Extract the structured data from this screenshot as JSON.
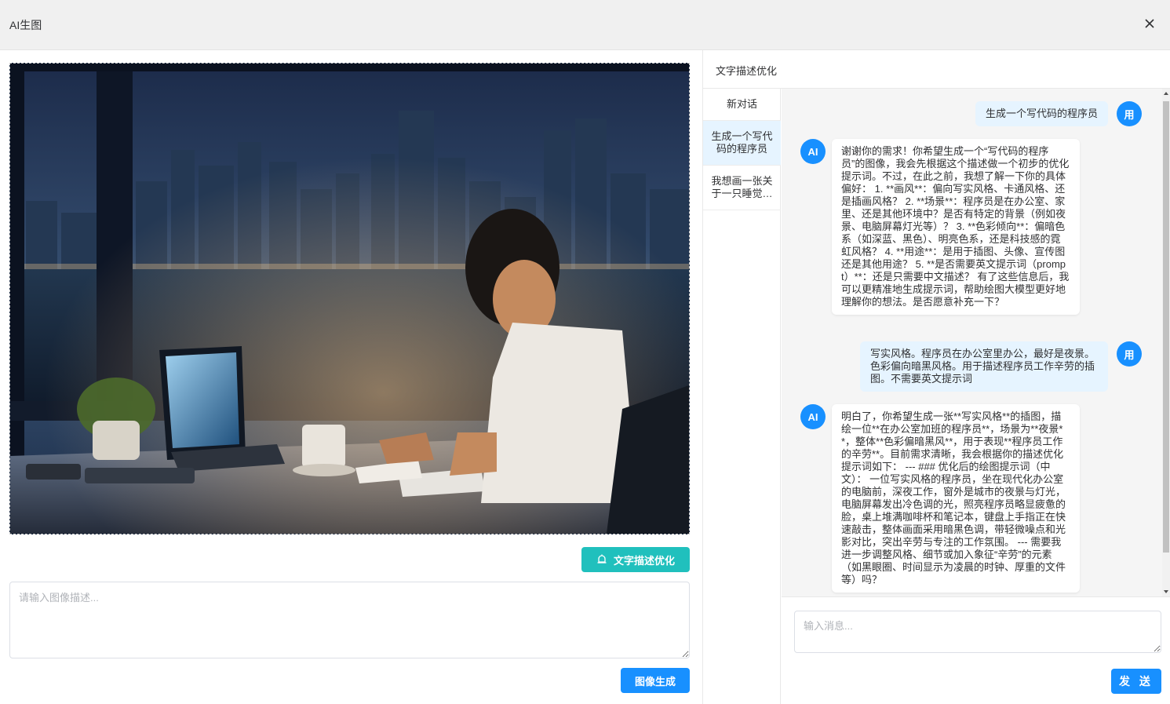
{
  "header": {
    "title": "AI生图",
    "close_icon": "close-icon"
  },
  "left": {
    "image_alt": "generated-image",
    "optimize_button": "文字描述优化",
    "optimize_icon": "bell-icon",
    "prompt_placeholder": "请输入图像描述...",
    "prompt_value": "",
    "generate_button": "图像生成"
  },
  "right": {
    "title": "文字描述优化",
    "conversations": [
      {
        "label": "新对话"
      },
      {
        "label": "生成一个写代码的程序员"
      },
      {
        "label": "我想画一张关于一只睡觉的猫"
      }
    ],
    "messages": [
      {
        "role": "user",
        "avatar": "用",
        "text": "生成一个写代码的程序员"
      },
      {
        "role": "ai",
        "avatar": "AI",
        "text": "谢谢你的需求！你希望生成一个“写代码的程序员”的图像，我会先根据这个描述做一个初步的优化提示词。不过，在此之前，我想了解一下你的具体偏好： 1. **画风**：偏向写实风格、卡通风格、还是插画风格？ 2. **场景**：程序员是在办公室、家里、还是其他环境中？是否有特定的背景（例如夜景、电脑屏幕灯光等）？ 3. **色彩倾向**：偏暗色系（如深蓝、黑色）、明亮色系，还是科技感的霓虹风格？ 4. **用途**：是用于插图、头像、宣传图还是其他用途？ 5. **是否需要英文提示词（prompt）**：还是只需要中文描述？ 有了这些信息后，我可以更精准地生成提示词，帮助绘图大模型更好地理解你的想法。是否愿意补充一下？"
      },
      {
        "role": "user",
        "avatar": "用",
        "text": "写实风格。程序员在办公室里办公，最好是夜景。色彩偏向暗黑风格。用于描述程序员工作辛劳的插图。不需要英文提示词"
      },
      {
        "role": "ai",
        "avatar": "AI",
        "text": "明白了，你希望生成一张**写实风格**的插图，描绘一位**在办公室加班的程序员**，场景为**夜景**，整体**色彩偏暗黑风**，用于表现**程序员工作的辛劳**。目前需求清晰，我会根据你的描述优化提示词如下： --- ### 优化后的绘图提示词（中文）： 一位写实风格的程序员，坐在现代化办公室的电脑前，深夜工作，窗外是城市的夜景与灯光，电脑屏幕发出冷色调的光，照亮程序员略显疲惫的脸，桌上堆满咖啡杯和笔记本，键盘上手指正在快速敲击，整体画面采用暗黑色调，带轻微噪点和光影对比，突出辛劳与专注的工作氛围。 --- 需要我进一步调整风格、细节或加入象征“辛劳”的元素（如黑眼圈、时间显示为凌晨的时钟、厚重的文件等）吗？"
      }
    ],
    "input_placeholder": "输入消息...",
    "input_value": "",
    "send_button": "发 送"
  }
}
